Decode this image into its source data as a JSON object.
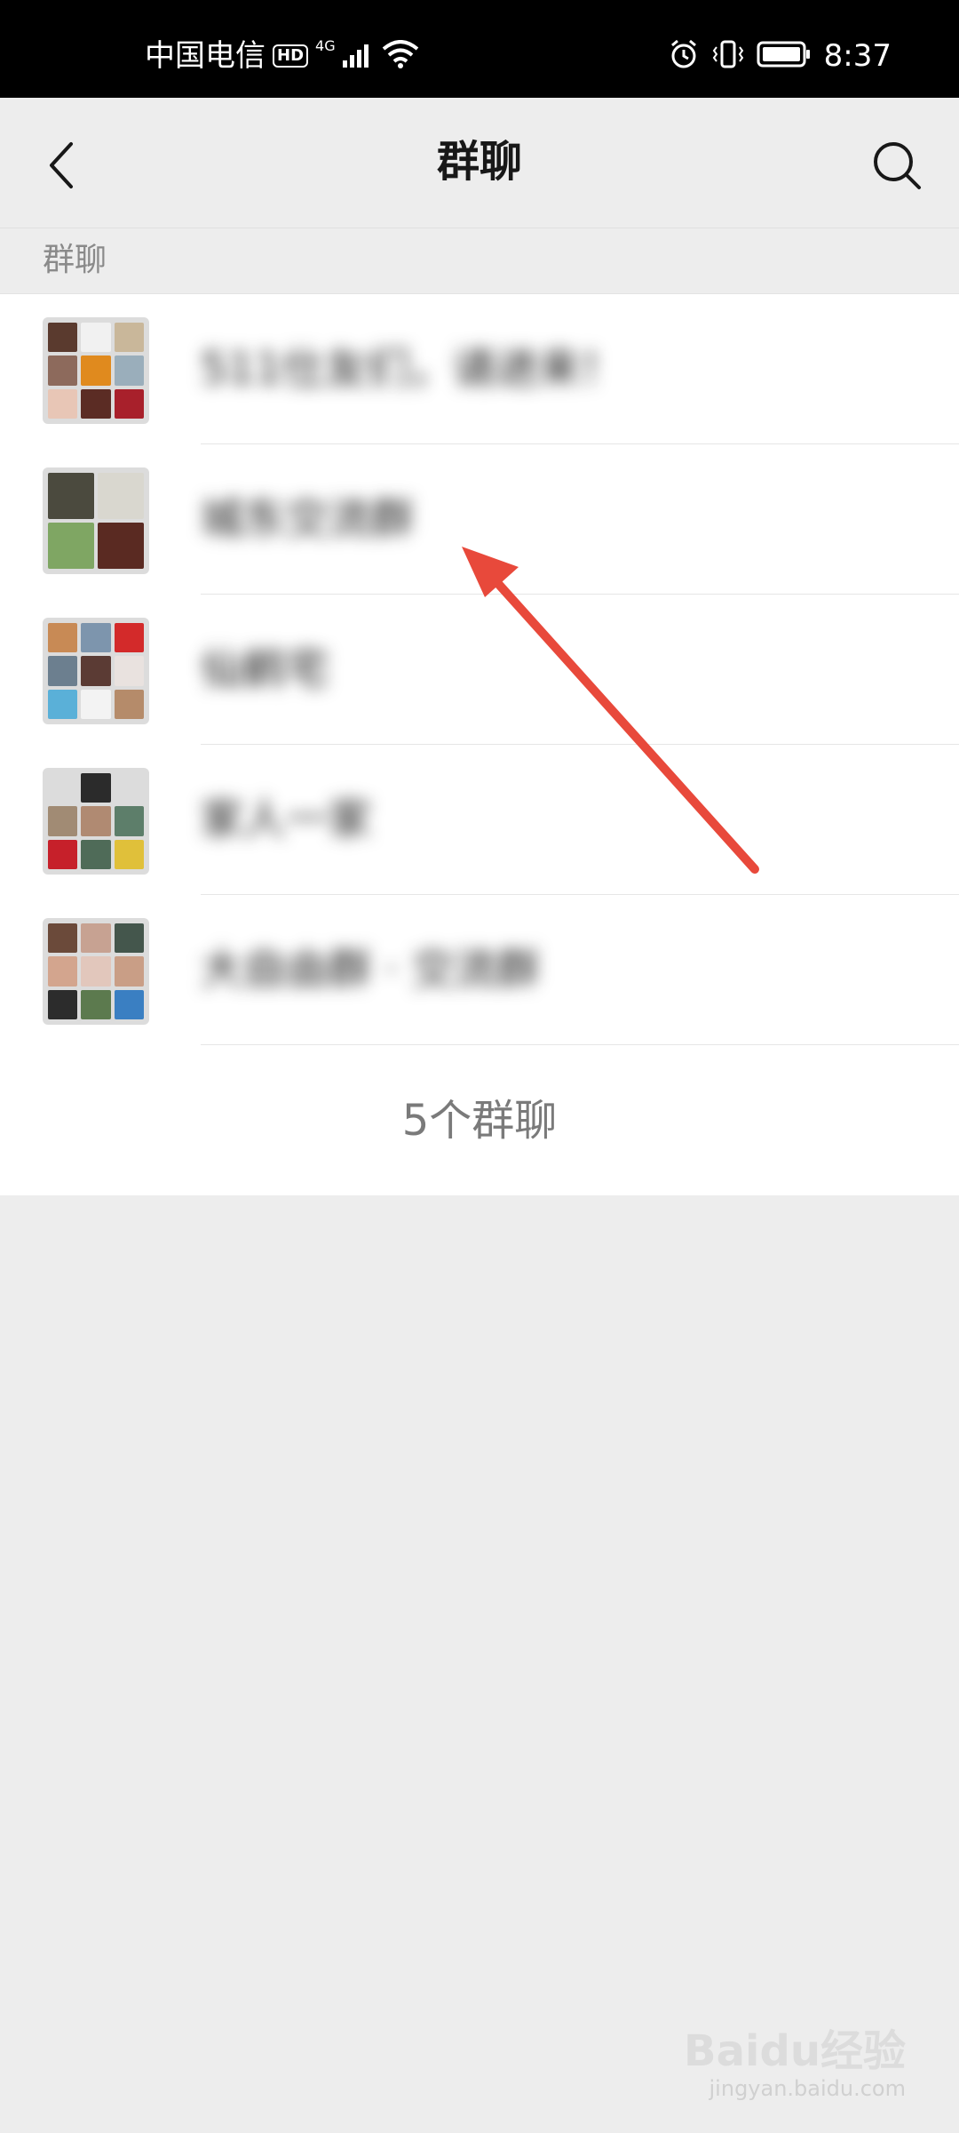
{
  "status_bar": {
    "carrier": "中国电信",
    "hd_badge": "HD",
    "network_type": "4G",
    "time": "8:37",
    "icons": [
      "signal-icon",
      "wifi-icon",
      "alarm-icon",
      "vibrate-icon",
      "battery-icon"
    ]
  },
  "title_bar": {
    "title": "群聊",
    "back_icon": "chevron-left-icon",
    "search_icon": "search-icon"
  },
  "section": {
    "header": "群聊"
  },
  "groups": [
    {
      "name": "511仕友们，请进来！"
    },
    {
      "name": "城东交流群"
    },
    {
      "name": "仙鹤宅"
    },
    {
      "name": "家人一家"
    },
    {
      "name": "大自由群 · 交流群"
    }
  ],
  "footer": {
    "count_label": "5个群聊"
  },
  "watermark": {
    "logo": "Baidu经验",
    "url": "jingyan.baidu.com"
  },
  "colors": {
    "status_bar_bg": "#000000",
    "page_bg": "#ededed",
    "list_bg": "#ffffff",
    "annotation_arrow": "#e8493b"
  }
}
